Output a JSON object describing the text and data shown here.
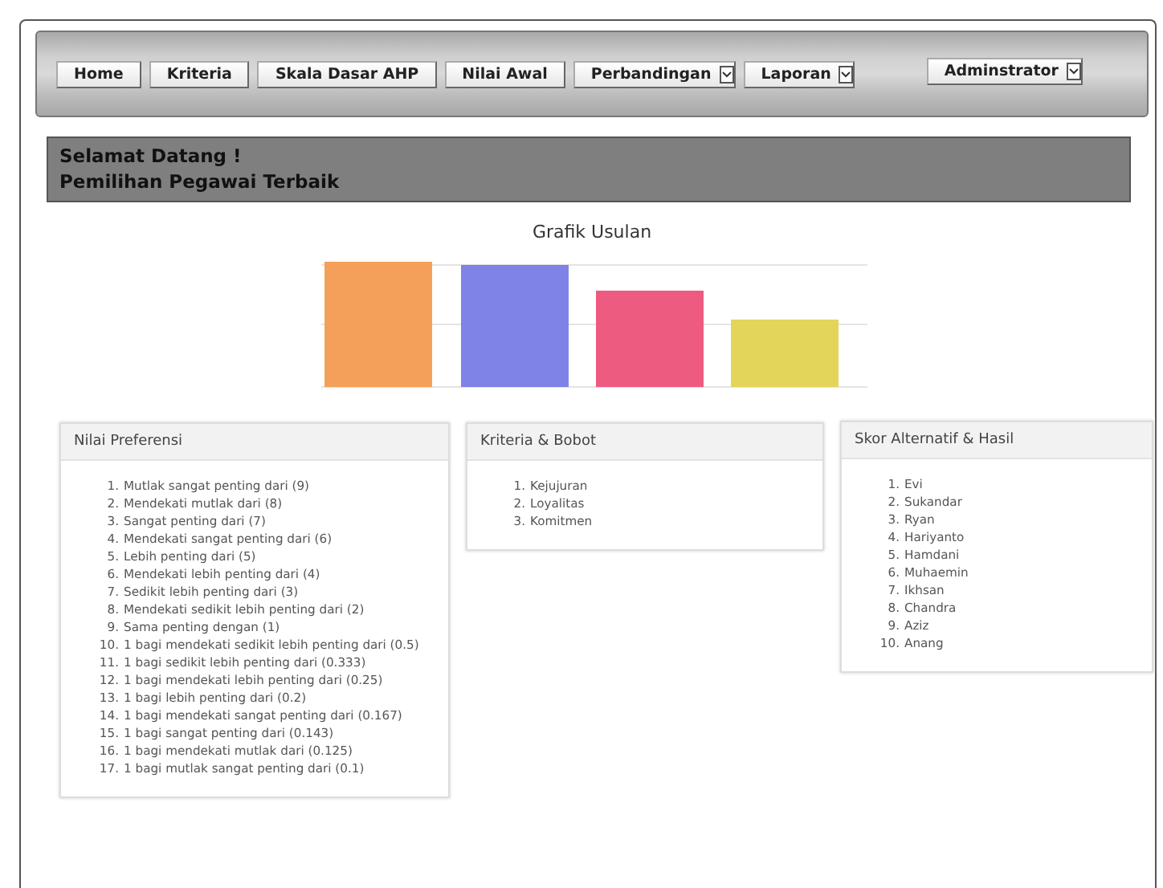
{
  "nav": {
    "items": [
      {
        "label": "Home",
        "kind": "link"
      },
      {
        "label": "Kriteria",
        "kind": "link"
      },
      {
        "label": "Skala Dasar AHP",
        "kind": "link"
      },
      {
        "label": "Nilai Awal",
        "kind": "link"
      },
      {
        "label": "Perbandingan",
        "kind": "dropdown"
      },
      {
        "label": "Laporan",
        "kind": "dropdown"
      }
    ],
    "user": {
      "label": "Adminstrator",
      "kind": "dropdown"
    }
  },
  "welcome": {
    "line_1": "Selamat Datang !",
    "line_2": "Pemilihan Pegawai Terbaik"
  },
  "chart": {
    "title": "Grafik Usulan"
  },
  "panels": [
    {
      "title": "Nilai Preferensi",
      "items": [
        {
          "number": "1.",
          "text": "Mutlak sangat penting dari (9)"
        },
        {
          "number": "2.",
          "text": "Mendekati mutlak dari (8)"
        },
        {
          "number": "3.",
          "text": "Sangat penting dari (7)"
        },
        {
          "number": "4.",
          "text": "Mendekati sangat penting dari (6)"
        },
        {
          "number": "5.",
          "text": "Lebih penting dari (5)"
        },
        {
          "number": "6.",
          "text": "Mendekati lebih penting dari (4)"
        },
        {
          "number": "7.",
          "text": "Sedikit lebih penting dari (3)"
        },
        {
          "number": "8.",
          "text": "Mendekati sedikit lebih penting dari (2)"
        },
        {
          "number": "9.",
          "text": "Sama penting dengan (1)"
        },
        {
          "number": "10.",
          "text": "1 bagi mendekati sedikit lebih penting dari (0.5)"
        },
        {
          "number": "11.",
          "text": "1 bagi sedikit lebih penting dari (0.333)"
        },
        {
          "number": "12.",
          "text": "1 bagi mendekati lebih penting dari (0.25)"
        },
        {
          "number": "13.",
          "text": "1 bagi lebih penting dari (0.2)"
        },
        {
          "number": "14.",
          "text": "1 bagi mendekati sangat penting dari (0.167)"
        },
        {
          "number": "15.",
          "text": "1 bagi sangat penting dari (0.143)"
        },
        {
          "number": "16.",
          "text": "1 bagi mendekati mutlak dari (0.125)"
        },
        {
          "number": "17.",
          "text": "1 bagi mutlak sangat penting dari (0.1)"
        }
      ]
    },
    {
      "title": "Kriteria & Bobot",
      "items": [
        {
          "number": "1.",
          "text": "Kejujuran"
        },
        {
          "number": "2.",
          "text": "Loyalitas"
        },
        {
          "number": "3.",
          "text": "Komitmen"
        }
      ]
    },
    {
      "title": "Skor Alternatif & Hasil",
      "items": [
        {
          "number": "1.",
          "text": "Evi"
        },
        {
          "number": "2.",
          "text": "Sukandar"
        },
        {
          "number": "3.",
          "text": "Ryan"
        },
        {
          "number": "4.",
          "text": "Hariyanto"
        },
        {
          "number": "5.",
          "text": "Hamdani"
        },
        {
          "number": "6.",
          "text": "Muhaemin"
        },
        {
          "number": "7.",
          "text": "Ikhsan"
        },
        {
          "number": "8.",
          "text": "Chandra"
        },
        {
          "number": "9.",
          "text": "Aziz"
        },
        {
          "number": "10.",
          "text": "Anang"
        }
      ]
    }
  ]
}
